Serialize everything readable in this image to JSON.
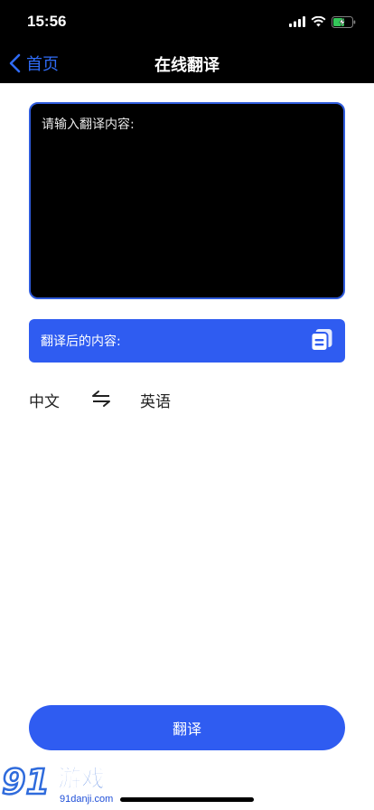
{
  "status_bar": {
    "time": "15:56"
  },
  "nav": {
    "back_label": "首页",
    "title": "在线翻译"
  },
  "input": {
    "placeholder": "请输入翻译内容:",
    "value": ""
  },
  "output": {
    "label": "翻译后的内容:"
  },
  "languages": {
    "source": "中文",
    "target": "英语"
  },
  "actions": {
    "translate_label": "翻译"
  },
  "watermark": {
    "url": "91danji.com"
  },
  "colors": {
    "accent": "#2f5cf1",
    "nav_bg": "#000000",
    "back_link": "#2f6bf5"
  }
}
